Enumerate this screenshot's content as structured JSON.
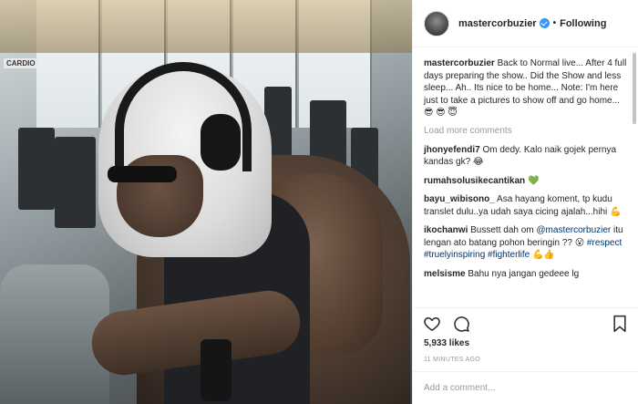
{
  "header": {
    "username": "mastercorbuzier",
    "separator": "•",
    "follow_label": "Following"
  },
  "photo": {
    "sign_label": "CARDIO"
  },
  "caption": {
    "username": "mastercorbuzier",
    "text": "Back to Normal live... After 4 full days preparing the show.. Did the Show and less sleep... Ah.. Its nice to be home... Note: I'm here just to take a pictures to show off and go home...",
    "emoji": "😎 😎 😇"
  },
  "load_more_label": "Load more comments",
  "comments": [
    {
      "username": "jhonyefendi7",
      "text": "Om dedy. Kalo naik gojek pernya kandas gk?",
      "emoji": "😂"
    },
    {
      "username": "rumahsolusikecantikan",
      "text": "",
      "emoji": "💚"
    },
    {
      "username": "bayu_wibisono_",
      "text": "Asa hayang koment, tp kudu translet dulu..ya udah saya cicing ajalah...hihi",
      "emoji": "💪"
    },
    {
      "username": "ikochanwi",
      "text_before": "Bussett dah om",
      "mention": "@mastercorbuzier",
      "text_after": "itu lengan ato batang pohon beringin ??",
      "emoji1": "😮",
      "tag1": "#respect",
      "tag2": "#truelyinspiring",
      "tag3": "#fighterlife",
      "emoji2": "💪👍"
    },
    {
      "username": "melsisme",
      "text": "Bahu nya jangan gedeee lg",
      "emoji": ""
    }
  ],
  "likes": "5,933 likes",
  "timestamp": "11 MINUTES AGO",
  "add_comment_placeholder": "Add a comment...",
  "icons": [
    "heart-icon",
    "comment-icon",
    "bookmark-icon",
    "verified-badge-icon"
  ],
  "colors": {
    "link": "#003569",
    "verified": "#3897f0",
    "muted": "#999999",
    "text": "#262626"
  }
}
